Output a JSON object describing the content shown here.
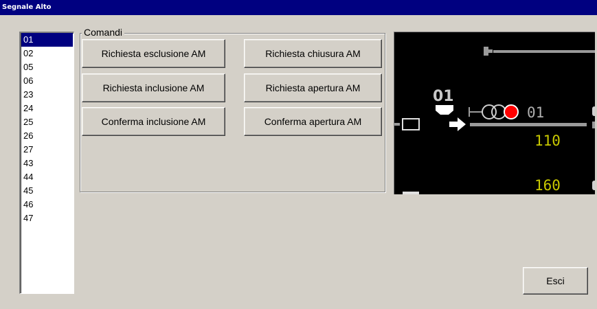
{
  "window": {
    "title": "Segnale Alto"
  },
  "signal_list": {
    "items": [
      "01",
      "02",
      "05",
      "06",
      "23",
      "24",
      "25",
      "26",
      "27",
      "43",
      "44",
      "45",
      "46",
      "47"
    ],
    "selected_index": 0
  },
  "commands": {
    "legend": "Comandi",
    "buttons": {
      "richiesta_esclusione": "Richiesta esclusione AM",
      "richiesta_chiusura": "Richiesta chiusura AM",
      "richiesta_inclusione": "Richiesta inclusione AM",
      "richiesta_apertura": "Richiesta apertura AM",
      "conferma_inclusione": "Conferma inclusione AM",
      "conferma_apertura": "Conferma apertura AM"
    }
  },
  "track_view": {
    "signal_label": "01",
    "signal_name": "01",
    "speed_upper": "110",
    "speed_lower": "160",
    "colors": {
      "background": "#000000",
      "track": "#9a9a9a",
      "label": "#c8c8c8",
      "speed": "#c8c800",
      "red_aspect": "#ff0000",
      "white": "#ffffff"
    }
  },
  "footer": {
    "exit_label": "Esci"
  }
}
